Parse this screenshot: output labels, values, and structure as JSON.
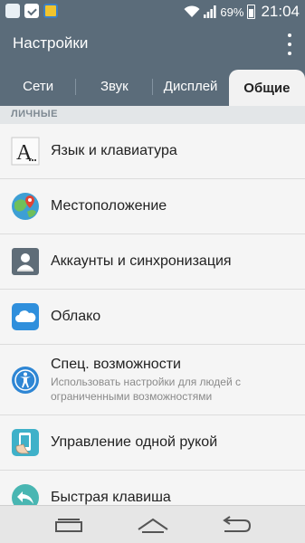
{
  "status_bar": {
    "battery": "69%",
    "time": "21:04"
  },
  "app": {
    "title": "Настройки"
  },
  "tabs": [
    {
      "label": "Сети"
    },
    {
      "label": "Звук"
    },
    {
      "label": "Дисплей"
    },
    {
      "label": "Общие",
      "active": true
    }
  ],
  "section": {
    "label": "ЛИЧНЫЕ"
  },
  "items": [
    {
      "title": "Язык и клавиатура",
      "icon": "language-icon"
    },
    {
      "title": "Местоположение",
      "icon": "location-icon"
    },
    {
      "title": "Аккаунты и синхронизация",
      "icon": "accounts-icon"
    },
    {
      "title": "Облако",
      "icon": "cloud-icon"
    },
    {
      "title": "Спец. возможности",
      "subtitle": "Использовать настройки для людей с ограниченными возможностями",
      "icon": "accessibility-icon"
    },
    {
      "title": "Управление одной рукой",
      "icon": "one-hand-icon"
    },
    {
      "title": "Быстрая клавиша",
      "icon": "shortcut-key-icon"
    }
  ]
}
